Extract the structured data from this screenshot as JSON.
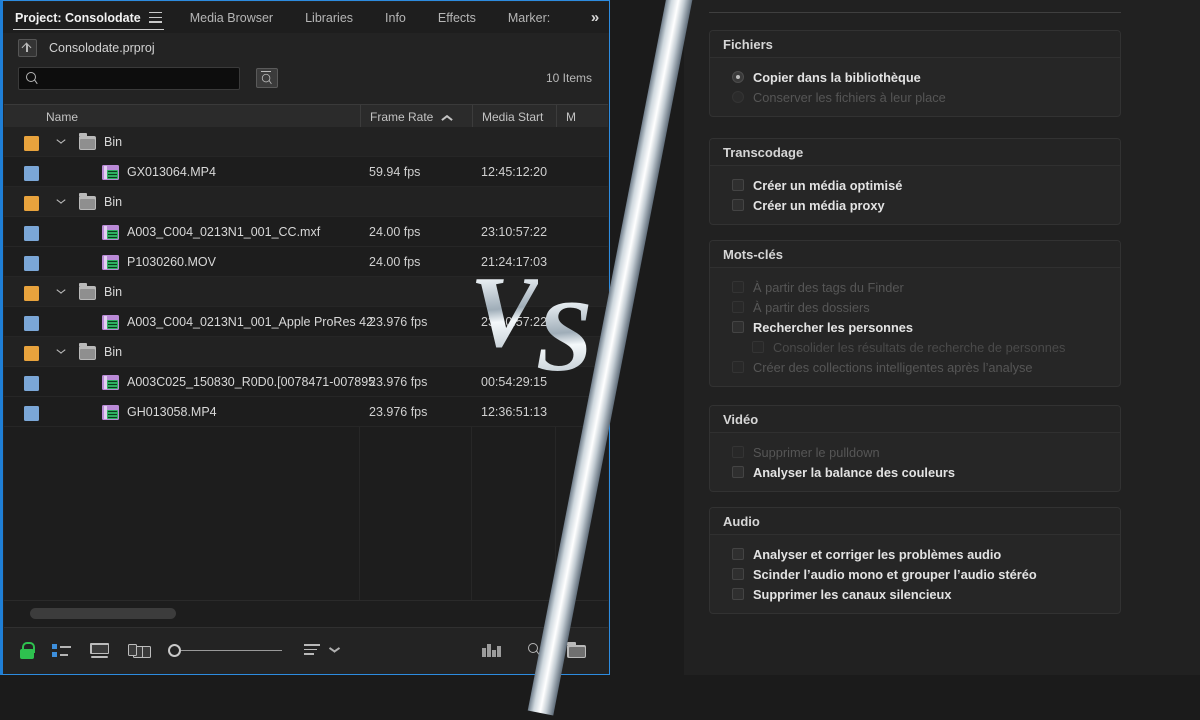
{
  "premiere_panel": {
    "tabs": [
      {
        "id": "project",
        "label": "Project: Consolodate",
        "active": true
      },
      {
        "id": "media-browser",
        "label": "Media Browser",
        "active": false
      },
      {
        "id": "libraries",
        "label": "Libraries",
        "active": false
      },
      {
        "id": "info",
        "label": "Info",
        "active": false
      },
      {
        "id": "effects",
        "label": "Effects",
        "active": false
      },
      {
        "id": "markers",
        "label": "Marker:",
        "active": false
      }
    ],
    "tabs_overflow_label": "»",
    "project_file": "Consolodate.prproj",
    "search": {
      "value": "",
      "placeholder": ""
    },
    "items_count": "10 Items",
    "columns": [
      {
        "id": "name",
        "label": "Name"
      },
      {
        "id": "frame-rate",
        "label": "Frame Rate",
        "sorted": true,
        "sort_dir": "asc"
      },
      {
        "id": "media-start",
        "label": "Media Start"
      },
      {
        "id": "media-end",
        "label": "M"
      }
    ],
    "rows": [
      {
        "type": "bin",
        "swatch": "#e8a33d",
        "name": "Bin",
        "frame_rate": "",
        "media_start": ""
      },
      {
        "type": "clip",
        "swatch": "#7ba7d7",
        "name": "GX013064.MP4",
        "frame_rate": "59.94 fps",
        "media_start": "12:45:12:20"
      },
      {
        "type": "bin",
        "swatch": "#e8a33d",
        "name": "Bin",
        "frame_rate": "",
        "media_start": ""
      },
      {
        "type": "clip",
        "swatch": "#7ba7d7",
        "name": "A003_C004_0213N1_001_CC.mxf",
        "frame_rate": "24.00 fps",
        "media_start": "23:10:57:22"
      },
      {
        "type": "clip",
        "swatch": "#7ba7d7",
        "name": "P1030260.MOV",
        "frame_rate": "24.00 fps",
        "media_start": "21:24:17:03"
      },
      {
        "type": "bin",
        "swatch": "#e8a33d",
        "name": "Bin",
        "frame_rate": "",
        "media_start": ""
      },
      {
        "type": "clip",
        "swatch": "#7ba7d7",
        "name": "A003_C004_0213N1_001_Apple ProRes 42",
        "frame_rate": "23.976 fps",
        "media_start": "23:10:57:22"
      },
      {
        "type": "bin",
        "swatch": "#e8a33d",
        "name": "Bin",
        "frame_rate": "",
        "media_start": ""
      },
      {
        "type": "clip",
        "swatch": "#7ba7d7",
        "name": "A003C025_150830_R0D0.[0078471-007895",
        "frame_rate": "23.976 fps",
        "media_start": "00:54:29:15"
      },
      {
        "type": "clip",
        "swatch": "#7ba7d7",
        "name": "GH013058.MP4",
        "frame_rate": "23.976 fps",
        "media_start": "12:36:51:13"
      }
    ],
    "toolbar": [
      {
        "id": "lock",
        "icon": "lock-open-icon",
        "color": "#2ec14f"
      },
      {
        "id": "list-view",
        "icon": "list-view-icon",
        "color": "#3d8fdc"
      },
      {
        "id": "icon-view",
        "icon": "icon-view-icon"
      },
      {
        "id": "freeform-view",
        "icon": "freeform-view-icon"
      },
      {
        "id": "zoom-slider",
        "icon": "zoom-slider"
      },
      {
        "id": "sort-icon",
        "icon": "sort-icon"
      },
      {
        "id": "sort-caret",
        "icon": "chevron-down-icon"
      },
      {
        "id": "automate-to-sequence",
        "icon": "bars-icon"
      },
      {
        "id": "find",
        "icon": "search-icon"
      },
      {
        "id": "new-bin",
        "icon": "folder-icon"
      }
    ]
  },
  "import_options_panel": {
    "groups": [
      {
        "id": "fichiers",
        "title": "Fichiers",
        "control": "radio",
        "options": [
          {
            "label": "Copier dans la bibliothèque",
            "selected": true,
            "state": "on"
          },
          {
            "label": "Conserver les fichiers à leur place",
            "selected": false,
            "state": "off"
          }
        ]
      },
      {
        "id": "transcodage",
        "title": "Transcodage",
        "control": "checkbox",
        "options": [
          {
            "label": "Créer un média optimisé",
            "selected": false,
            "state": "on"
          },
          {
            "label": "Créer un média proxy",
            "selected": false,
            "state": "on"
          }
        ]
      },
      {
        "id": "mots-cles",
        "title": "Mots-clés",
        "control": "checkbox",
        "options": [
          {
            "label": "À partir des tags du Finder",
            "selected": false,
            "state": "off"
          },
          {
            "label": "À partir des dossiers",
            "selected": false,
            "state": "off"
          },
          {
            "label": "Rechercher les personnes",
            "selected": false,
            "state": "on"
          },
          {
            "label": "Consolider les résultats de recherche de personnes",
            "selected": false,
            "state": "dim",
            "indent": true
          },
          {
            "label": "Créer des collections intelligentes après l’analyse",
            "selected": false,
            "state": "off"
          }
        ]
      },
      {
        "id": "video",
        "title": "Vidéo",
        "control": "checkbox",
        "options": [
          {
            "label": "Supprimer le pulldown",
            "selected": false,
            "state": "off"
          },
          {
            "label": "Analyser la balance des couleurs",
            "selected": false,
            "state": "on"
          }
        ]
      },
      {
        "id": "audio",
        "title": "Audio",
        "control": "checkbox",
        "options": [
          {
            "label": "Analyser et corriger les problèmes audio",
            "selected": false,
            "state": "on"
          },
          {
            "label": "Scinder l’audio mono et grouper l’audio stéréo",
            "selected": false,
            "state": "on"
          },
          {
            "label": "Supprimer les canaux silencieux",
            "selected": false,
            "state": "on"
          }
        ]
      }
    ]
  },
  "vs_divider": {
    "letter_1": "V",
    "letter_2": "S"
  },
  "colors": {
    "accent_blue": "#2d8ce0",
    "bin_swatch": "#e8a33d",
    "clip_swatch": "#7ba7d7",
    "lock_green": "#2ec14f",
    "panel_bg": "#232323",
    "list_bg": "#1d1d1d",
    "mac_bg": "#212121"
  }
}
